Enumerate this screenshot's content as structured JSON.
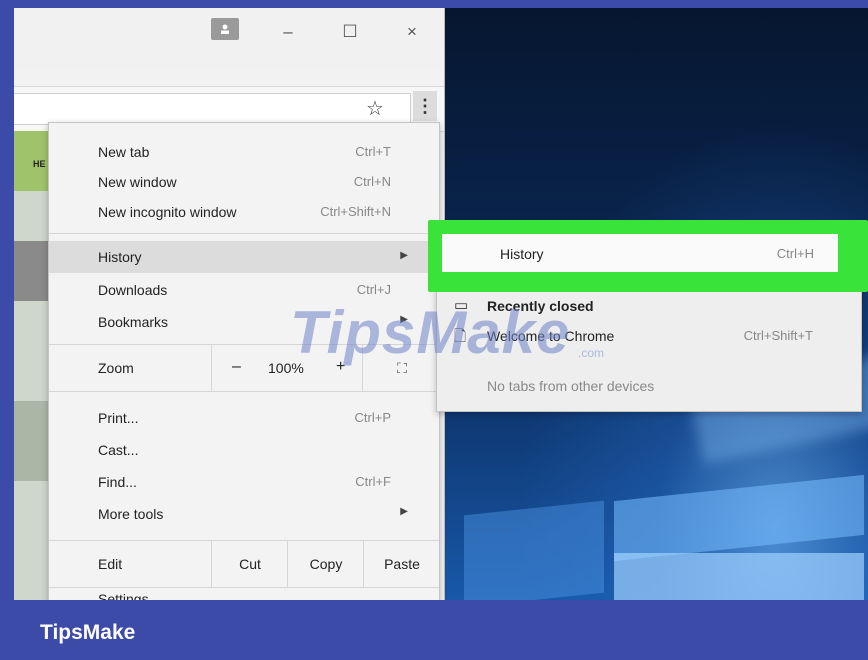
{
  "window": {
    "minimize": "–",
    "maximize": "☐",
    "close": "×"
  },
  "toolbar": {
    "star": "☆",
    "menu": "⋮"
  },
  "page_behind": {
    "tab_text": "HE"
  },
  "menu": {
    "items": [
      {
        "label": "New tab",
        "shortcut": "Ctrl+T"
      },
      {
        "label": "New window",
        "shortcut": "Ctrl+N"
      },
      {
        "label": "New incognito window",
        "shortcut": "Ctrl+Shift+N"
      },
      {
        "label": "History",
        "shortcut": ""
      },
      {
        "label": "Downloads",
        "shortcut": "Ctrl+J"
      },
      {
        "label": "Bookmarks",
        "shortcut": ""
      },
      {
        "label": "Print...",
        "shortcut": "Ctrl+P"
      },
      {
        "label": "Cast...",
        "shortcut": ""
      },
      {
        "label": "Find...",
        "shortcut": "Ctrl+F"
      },
      {
        "label": "More tools",
        "shortcut": ""
      },
      {
        "label": "Settings",
        "shortcut": ""
      }
    ],
    "zoom": {
      "label": "Zoom",
      "minus": "–",
      "value": "100%",
      "plus": "+",
      "fullscreen": "⛶"
    },
    "edit": {
      "label": "Edit",
      "cut": "Cut",
      "copy": "Copy",
      "paste": "Paste"
    }
  },
  "submenu": {
    "history": {
      "label": "History",
      "shortcut": "Ctrl+H"
    },
    "recently_closed": "Recently closed",
    "welcome": {
      "label": "Welcome to Chrome",
      "shortcut": "Ctrl+Shift+T"
    },
    "no_tabs": "No tabs from other devices"
  },
  "watermark": {
    "main": "TipsMake",
    "small": ".com"
  },
  "footer": {
    "brand": "TipsMake"
  },
  "colors": {
    "highlight": "#39e33a",
    "footer": "#3c4aa8"
  }
}
